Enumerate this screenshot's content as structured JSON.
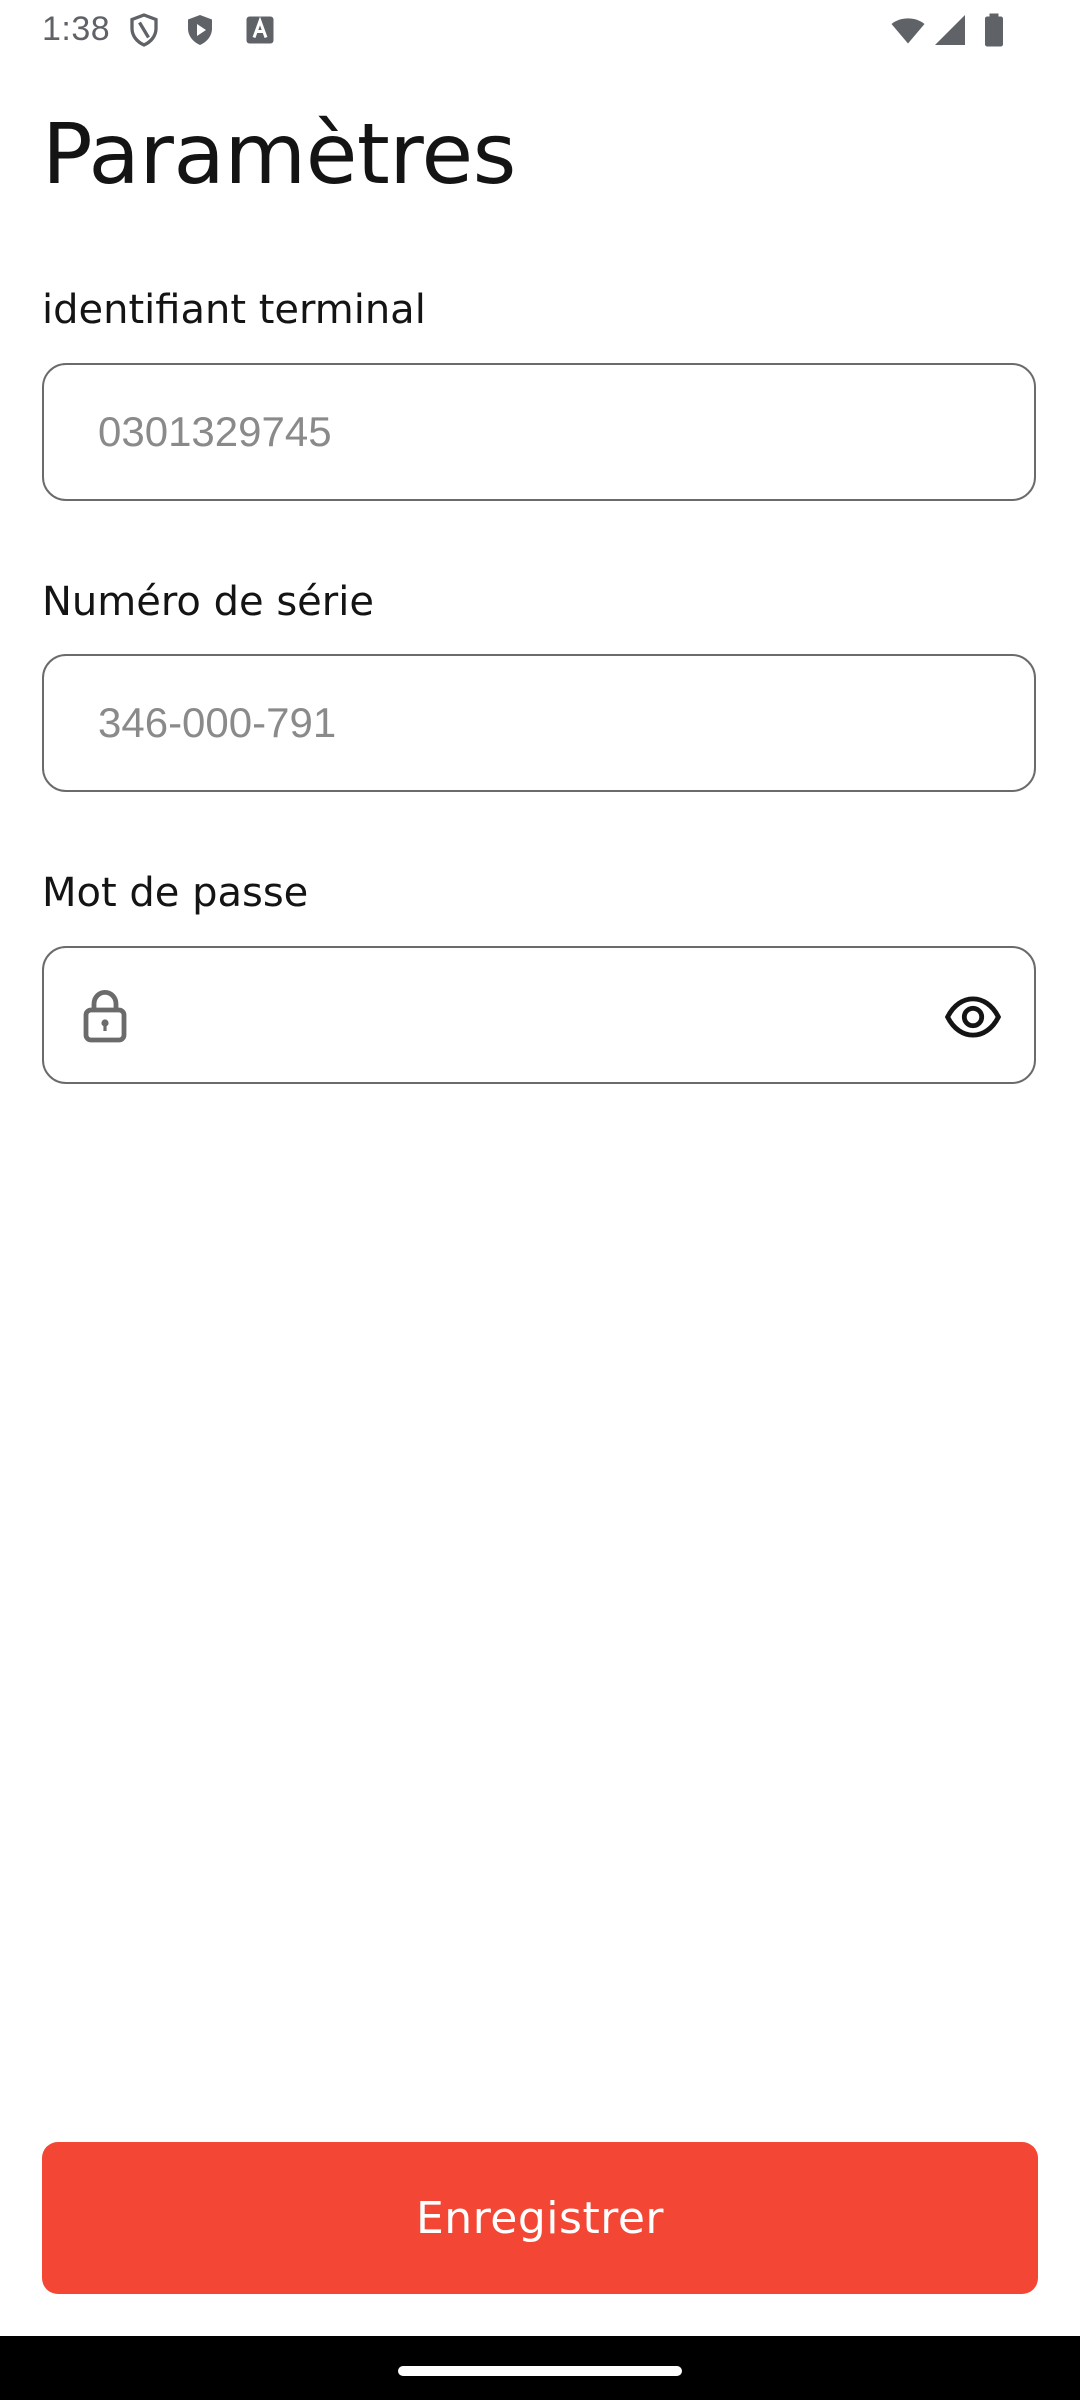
{
  "status_bar": {
    "time": "1:38",
    "icons": [
      "shield-outline-icon",
      "shield-play-icon",
      "text-a-icon",
      "wifi-icon",
      "signal-icon",
      "battery-icon"
    ]
  },
  "page": {
    "title": "Paramètres"
  },
  "form": {
    "terminal_id": {
      "label": "identifiant terminal",
      "placeholder": "0301329745",
      "value": ""
    },
    "serial_number": {
      "label": "Numéro de série",
      "placeholder": "346-000-791",
      "value": ""
    },
    "password": {
      "label": "Mot de passe",
      "placeholder": "",
      "value": "",
      "leading_icon": "lock-icon",
      "trailing_icon": "eye-icon"
    }
  },
  "actions": {
    "save_label": "Enregistrer"
  },
  "colors": {
    "accent": "#f44634",
    "text": "#141414",
    "border": "#6b6b6b",
    "placeholder": "#8a8a8a"
  }
}
